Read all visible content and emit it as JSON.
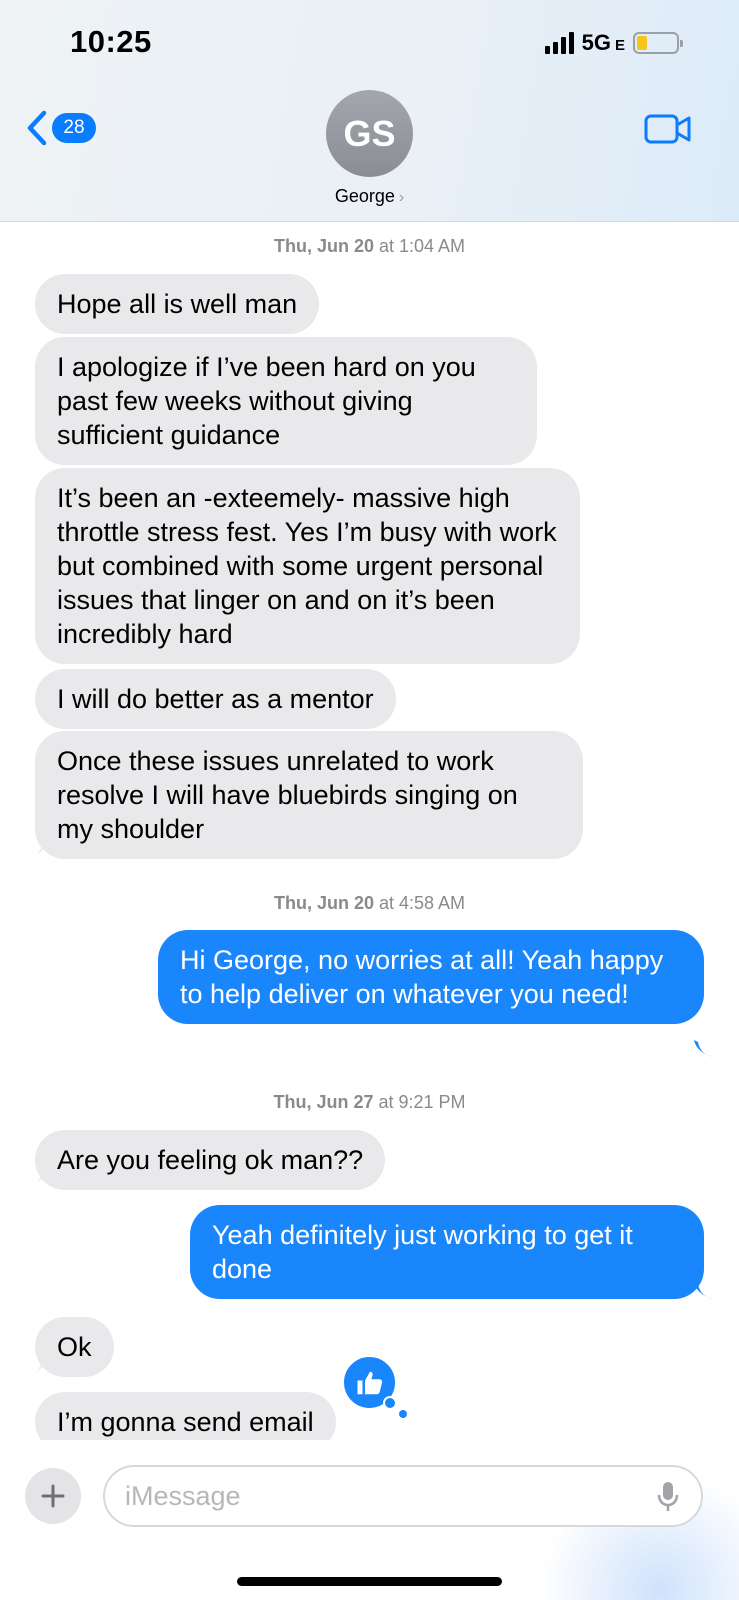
{
  "status_bar": {
    "time": "10:25",
    "network": "5G",
    "network_suffix": "E",
    "battery_level": 0.26
  },
  "nav": {
    "back_count": "28",
    "avatar_initials": "GS",
    "contact_name": "George",
    "contact_chevron": "›",
    "icons": {
      "back": "chevron-left-icon",
      "video": "video-camera-icon"
    }
  },
  "conversation": {
    "timestamps": [
      {
        "day": "Thu, Jun 20",
        "time": " at 1:04 AM"
      },
      {
        "day": "Thu, Jun 20",
        "time": " at 4:58 AM"
      },
      {
        "day": "Thu, Jun 27",
        "time": " at 9:21 PM"
      }
    ],
    "messages": [
      {
        "direction": "incoming",
        "text": "Hope all is well man"
      },
      {
        "direction": "incoming",
        "text": "I apologize if I’ve been hard on you past few weeks without giving sufficient guidance"
      },
      {
        "direction": "incoming",
        "text": "It’s been an -exteemely- massive high throttle stress fest.  Yes I’m busy with work but combined with some urgent personal issues that linger on and on it’s been incredibly hard"
      },
      {
        "direction": "incoming",
        "text": "I will do better as a mentor"
      },
      {
        "direction": "incoming",
        "text": "Once these issues unrelated to work resolve I will have bluebirds singing on my shoulder"
      },
      {
        "direction": "outgoing",
        "text": "Hi George, no worries at all! Yeah happy to help deliver on whatever you need!"
      },
      {
        "direction": "incoming",
        "text": "Are you feeling ok man??"
      },
      {
        "direction": "outgoing",
        "text": "Yeah definitely just working to get it done"
      },
      {
        "direction": "incoming",
        "text": "Ok"
      },
      {
        "direction": "incoming",
        "text": "I’m gonna send email"
      }
    ],
    "reaction": {
      "on_message": "Ok",
      "icon": "thumbs-up-icon",
      "color": "#1a86fb"
    }
  },
  "composer": {
    "placeholder": "iMessage",
    "value": "",
    "icons": {
      "add": "plus-icon",
      "dictation": "microphone-icon"
    }
  },
  "colors": {
    "outgoing_bubble": "#1a86fb",
    "incoming_bubble": "#e9e9eb",
    "accent": "#0a7cff"
  }
}
